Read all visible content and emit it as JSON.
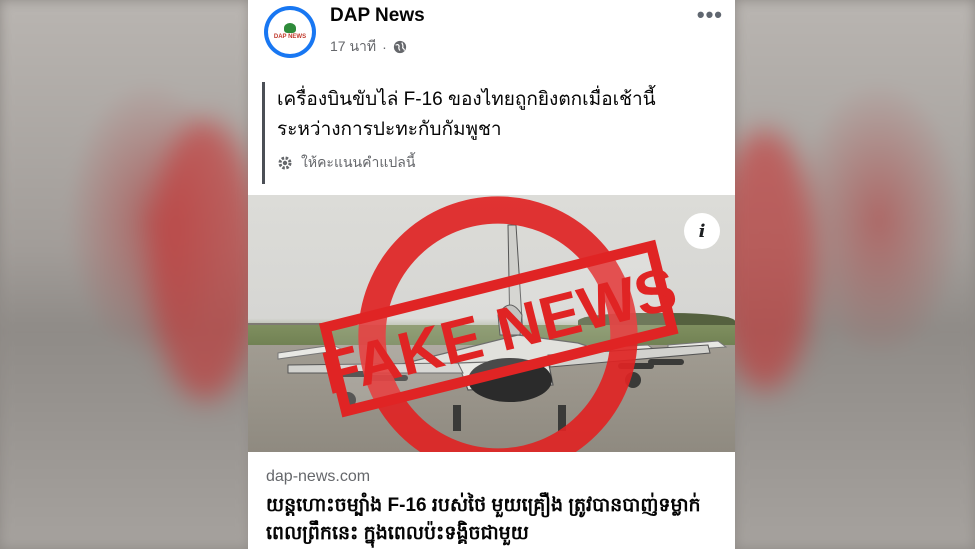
{
  "post": {
    "page_name": "DAP News",
    "logo_text": "DAP NEWS",
    "time": "17 นาที",
    "separator": "·",
    "more": "•••",
    "caption_line1": "เครื่องบินขับไล่ F-16 ของไทยถูกยิงตกเมื่อเช้านี้",
    "caption_line2": "ระหว่างการปะทะกับกัมพูชา",
    "translate_label": "ให้คะแนนคำแปลนี้"
  },
  "image": {
    "info_label": "i",
    "stamp_text": "FAKE NEWS",
    "stamp_color": "#e02424"
  },
  "link": {
    "domain": "dap-news.com",
    "headline": "យន្តហោះចម្បាំង F-16 របស់ថៃ មួយគ្រឿង ត្រូវបានបាញ់ទម្លាក់ ពេលព្រឹកនេះ ក្នុងពេលប៉ះទង្គិចជាមួយ"
  },
  "colors": {
    "accent": "#1877f2",
    "text_primary": "#050505",
    "text_secondary": "#65676b"
  }
}
